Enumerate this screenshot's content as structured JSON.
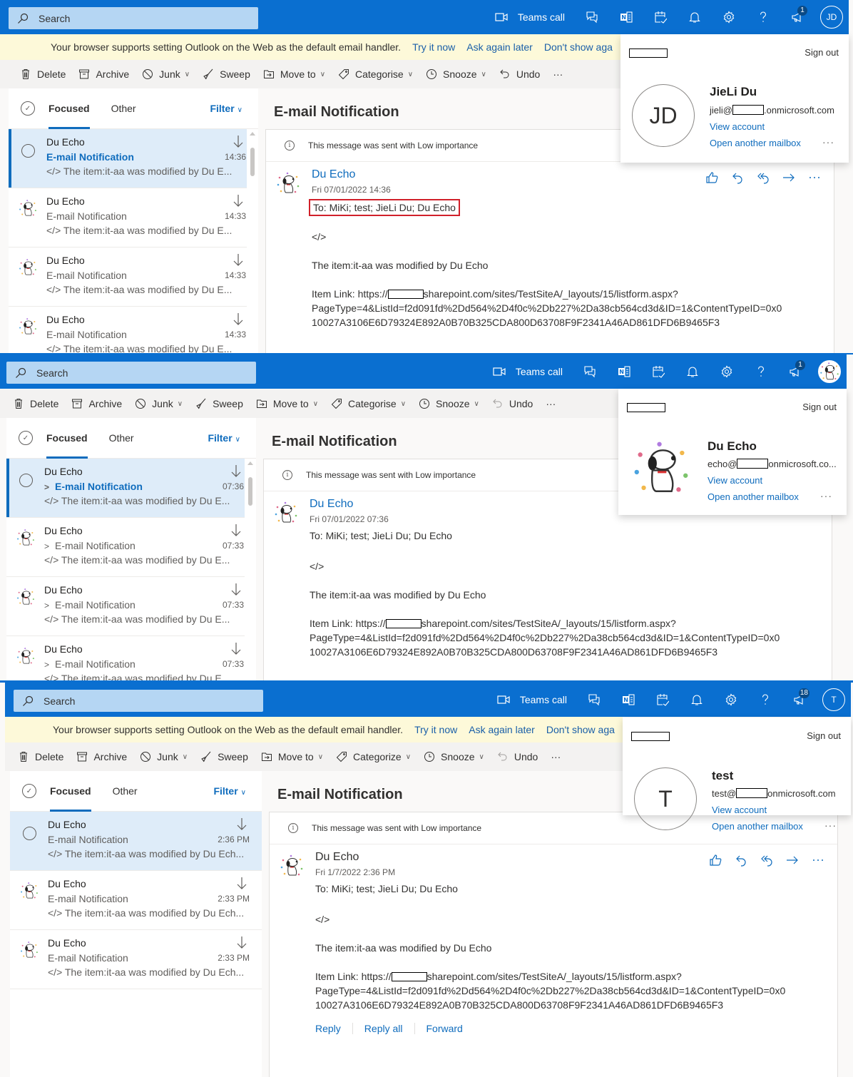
{
  "common": {
    "search_placeholder": "Search",
    "teams_call": "Teams call",
    "banner_text": "Your browser supports setting Outlook on the Web as the default email handler.",
    "banner_try": "Try it now",
    "banner_ask": "Ask again later",
    "banner_dont": "Don't show aga",
    "cmd_delete": "Delete",
    "cmd_archive": "Archive",
    "cmd_junk": "Junk",
    "cmd_sweep": "Sweep",
    "cmd_move": "Move to",
    "cmd_snooze": "Snooze",
    "cmd_undo": "Undo",
    "cmd_more": "···",
    "tab_focused": "Focused",
    "tab_other": "Other",
    "filter": "Filter",
    "subject": "E-mail Notification",
    "importance": "This message was sent with Low importance",
    "to_line": "To:  MiKi; test; JieLi Du; Du Echo",
    "body_code": "</>",
    "body_line": "The item:it-aa was modified by Du Echo",
    "link_prefix": "Item Link: https://",
    "link_suffix": "sharepoint.com/sites/TestSiteA/_layouts/15/listform.aspx?",
    "link_line2": "PageType=4&ListId=f2d091fd%2Dd564%2D4f0c%2Db227%2Da38cb564cd3d&ID=1&ContentTypeID=0x0",
    "link_line3": "10027A3106E6D79324E892A0B70B325CDA800D63708F9F2341A46AD861DFD6B9465F3",
    "sign_out": "Sign out",
    "view_account": "View account",
    "open_mailbox": "Open another mailbox",
    "more": "···"
  },
  "panels": [
    {
      "categorise": "Categorise",
      "badge": "1",
      "top_avatar": "JD",
      "sender": "Du Echo",
      "date": "Fri 07/01/2022 14:36",
      "link_prefix": "Item Link: https://",
      "link_suffix": "sharepoint.com/sites/TestSiteA/_layouts/15/listform.aspx?",
      "profile": {
        "initials": "JD",
        "name": "JieLi Du",
        "email_user": "jieli@",
        "email_domain": ".onmicrosoft.com"
      },
      "messages": [
        {
          "from": "Du Echo",
          "subject": "E-mail Notification",
          "preview": "</> The item:it-aa was modified by Du E...",
          "time": "14:36",
          "selected": true,
          "unread": true
        },
        {
          "from": "Du Echo",
          "subject": "E-mail Notification",
          "preview": "</> The item:it-aa was modified by Du E...",
          "time": "14:33"
        },
        {
          "from": "Du Echo",
          "subject": "E-mail Notification",
          "preview": "</> The item:it-aa was modified by Du E...",
          "time": "14:33"
        },
        {
          "from": "Du Echo",
          "subject": "E-mail Notification",
          "preview": "</> The item:it-aa was modified by Du E...",
          "time": "14:33"
        }
      ]
    },
    {
      "categorise": "Categorise",
      "badge": "1",
      "sender": "Du Echo",
      "date": "Fri 07/01/2022 07:36",
      "profile": {
        "name": "Du Echo",
        "email_user": "echo@",
        "email_domain": "onmicrosoft.co..."
      },
      "messages": [
        {
          "from": "Du Echo",
          "subject": "E-mail Notification",
          "preview": "</> The item:it-aa was modified by Du E...",
          "time": "07:36",
          "selected": true,
          "unread": true
        },
        {
          "from": "Du Echo",
          "subject": "E-mail Notification",
          "preview": "</> The item:it-aa was modified by Du E...",
          "time": "07:33"
        },
        {
          "from": "Du Echo",
          "subject": "E-mail Notification",
          "preview": "</> The item:it-aa was modified by Du E...",
          "time": "07:33"
        },
        {
          "from": "Du Echo",
          "subject": "E-mail Notification",
          "preview": "</> The item:it-aa was modified by Du E...",
          "time": "07:33"
        }
      ]
    },
    {
      "categorise": "Categorize",
      "badge": "18",
      "top_avatar": "T",
      "sender": "Du Echo",
      "date": "Fri 1/7/2022 2:36 PM",
      "profile": {
        "initials": "T",
        "name": "test",
        "email_user": "test@",
        "email_domain": "onmicrosoft.com"
      },
      "reply": "Reply",
      "reply_all": "Reply all",
      "forward": "Forward",
      "messages": [
        {
          "from": "Du Echo",
          "subject": "E-mail Notification",
          "preview": "</> The item:it-aa was modified by Du Ech...",
          "time": "2:36 PM",
          "selected": true
        },
        {
          "from": "Du Echo",
          "subject": "E-mail Notification",
          "preview": "</> The item:it-aa was modified by Du Ech...",
          "time": "2:33 PM"
        },
        {
          "from": "Du Echo",
          "subject": "E-mail Notification",
          "preview": "</> The item:it-aa was modified by Du Ech...",
          "time": "2:33 PM"
        }
      ]
    }
  ]
}
